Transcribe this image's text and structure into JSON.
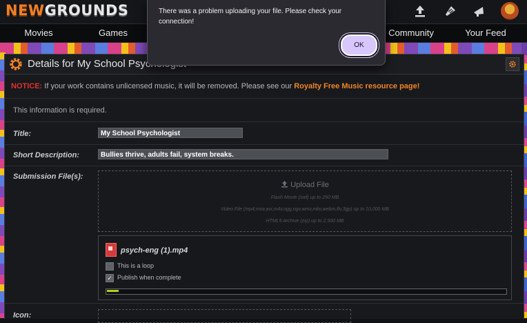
{
  "header": {
    "logo_prefix": "NEW",
    "logo_suffix": "GROUNDS",
    "icons": [
      "upload-icon",
      "broadcast-icon",
      "notifications-icon"
    ]
  },
  "nav": {
    "items": [
      "Movies",
      "Games",
      "Community",
      "Your Feed"
    ]
  },
  "panel": {
    "title": "Details for My School Psychologist",
    "notice": {
      "label": "NOTICE:",
      "text": " If your work contains unlicensed music, it will be removed. Please see our ",
      "link": "Royalty Free Music resource page!"
    },
    "required_text": "This information is required.",
    "title_label": "Title:",
    "title_value": "My School Psychologist",
    "short_desc_label": "Short Description:",
    "short_desc_value": "Bullies thrive, adults fail, system breaks.",
    "submission_label": "Submission File(s):",
    "upload": {
      "title": "Upload File",
      "lines": [
        "Flash Movie (swf) up to 250 MB",
        "Video File (mp4,mov,avi,m4v,ogg,ogv,wmv,mkv,webm,flv,3gp) up to 10,000 MB",
        "HTML5 Archive (zip) up to 2,500 MB"
      ]
    },
    "file": {
      "name": "psych-eng (1).mp4",
      "loop_label": "This is a loop",
      "loop_checked": false,
      "publish_label": "Publish when complete",
      "publish_checked": true,
      "progress_fraction": 0.03
    },
    "icon_label": "Icon:"
  },
  "dialog": {
    "message": "There was a problem uploading your file. Please check your connection!",
    "ok_label": "OK"
  },
  "colors": {
    "accent_orange": "#f07f24",
    "notice_red": "#e0332f",
    "progress_green": "#b8d01e",
    "ok_button": "#d8c6ff"
  }
}
